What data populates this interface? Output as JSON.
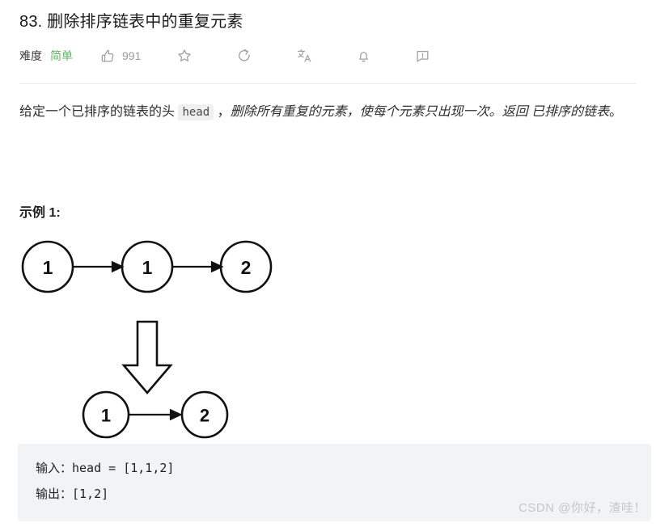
{
  "problem": {
    "title": "83. 删除排序链表中的重复元素",
    "difficulty_label": "难度",
    "difficulty_value": "简单",
    "difficulty_color": "#5cb85c",
    "like_count": "991"
  },
  "toolbar": {
    "like_icon": "thumbs-up-icon",
    "star_icon": "star-icon",
    "share_icon": "share-refresh-icon",
    "translate_icon": "translate-icon",
    "bell_icon": "bell-icon",
    "feedback_icon": "feedback-icon"
  },
  "description": {
    "part1": "给定一个已排序的链表的头 ",
    "code": "head",
    "part2": " ，",
    "italic": "删除所有重复的元素，使每个元素只出现一次。返回 已排序的链表",
    "part3": "。"
  },
  "example": {
    "heading": "示例 1:",
    "input_line": "输入：head = [1,1,2]",
    "output_line": "输出：[1,2]"
  },
  "diagram": {
    "input_nodes": [
      "1",
      "1",
      "2"
    ],
    "output_nodes": [
      "1",
      "2"
    ],
    "arrow_down": "down-block-arrow",
    "stroke_color": "#111111"
  },
  "watermark": {
    "text": "CSDN @你好，渣哇！"
  }
}
